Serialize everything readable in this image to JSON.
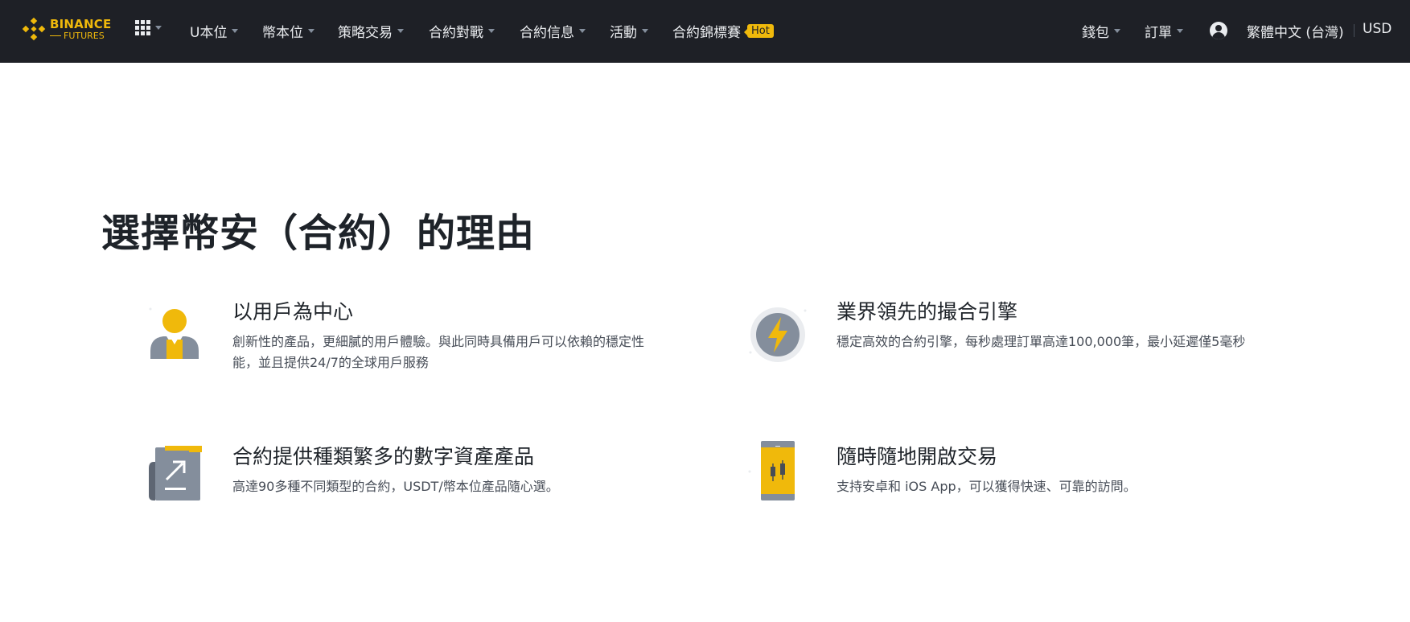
{
  "header": {
    "logo_line1": "BINANCE",
    "logo_line2": "FUTURES",
    "nav": [
      {
        "label": "U本位"
      },
      {
        "label": "幣本位"
      },
      {
        "label": "策略交易"
      },
      {
        "label": "合約對戰"
      },
      {
        "label": "合約信息"
      },
      {
        "label": "活動"
      },
      {
        "label": "合約錦標賽",
        "badge": "Hot"
      }
    ],
    "right": {
      "wallet": "錢包",
      "orders": "訂單",
      "language": "繁體中文 (台灣)",
      "currency": "USD"
    }
  },
  "main": {
    "headline": "選擇幣安（合約）的理由",
    "features": [
      {
        "icon": "user-center-icon",
        "title": "以用戶為中心",
        "desc": "創新性的產品，更細膩的用戶體驗。與此同時具備用戶可以依賴的穩定性能，並且提供24/7的全球用戶服務"
      },
      {
        "icon": "lightning-engine-icon",
        "title": "業界領先的撮合引擎",
        "desc": "穩定高效的合約引擎，每秒處理訂單高達100,000筆，最小延遲僅5毫秒"
      },
      {
        "icon": "document-trend-icon",
        "title": "合約提供種類繁多的數字資產產品",
        "desc": "高達90多種不同類型的合約，USDT/幣本位產品隨心選。"
      },
      {
        "icon": "mobile-chart-icon",
        "title": "隨時隨地開啟交易",
        "desc": "支持安卓和 iOS App，可以獲得快速、可靠的訪問。"
      }
    ]
  },
  "colors": {
    "brand_yellow": "#f0b90b",
    "nav_bg": "#1e2026",
    "icon_gray": "#848e9c"
  }
}
